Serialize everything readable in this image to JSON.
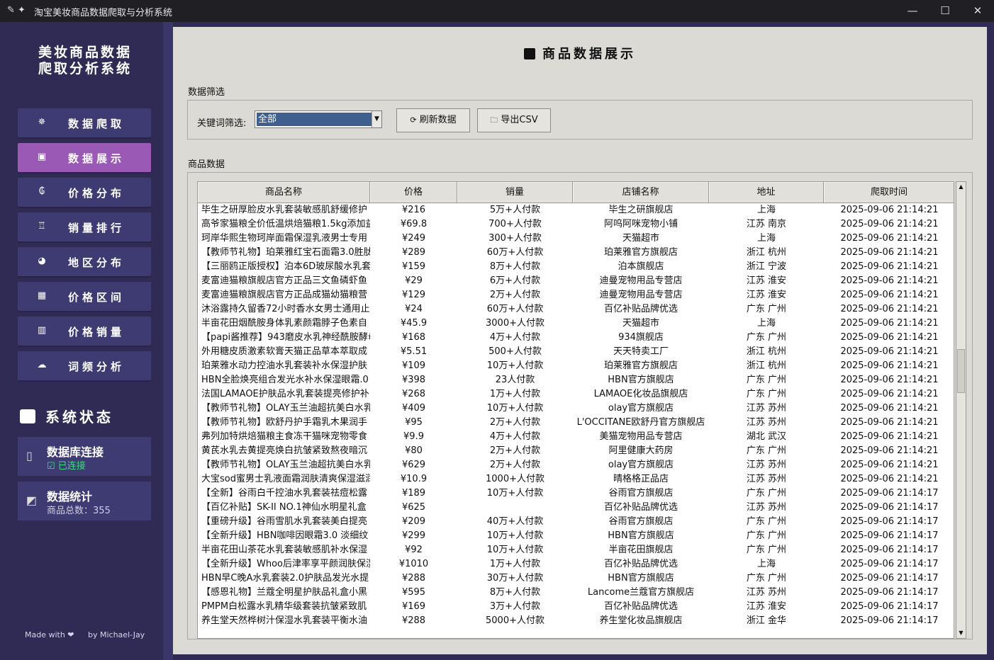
{
  "window": {
    "title": "淘宝美妆商品数据爬取与分析系统",
    "icons": "✎ ✦"
  },
  "sidebar": {
    "logo_line1": "美妆商品数据",
    "logo_line2": "爬取分析系统",
    "items": [
      {
        "label": "数据爬取",
        "icon": "✵",
        "icon_name": "spider-icon",
        "active": false
      },
      {
        "label": "数据展示",
        "icon": "▣",
        "icon_name": "box-icon",
        "active": true
      },
      {
        "label": "价格分布",
        "icon": "₲",
        "icon_name": "money-bag-icon",
        "active": false
      },
      {
        "label": "销量排行",
        "icon": "♖",
        "icon_name": "trophy-icon",
        "active": false
      },
      {
        "label": "地区分布",
        "icon": "◕",
        "icon_name": "globe-icon",
        "active": false
      },
      {
        "label": "价格区间",
        "icon": "▦",
        "icon_name": "chart-icon",
        "active": false
      },
      {
        "label": "价格销量",
        "icon": "▥",
        "icon_name": "bar-chart-icon",
        "active": false
      },
      {
        "label": "词频分析",
        "icon": "☁",
        "icon_name": "cloud-icon",
        "active": false
      }
    ],
    "system_status_title": "系统状态",
    "db_card": {
      "title": "数据库连接",
      "status": "☑ 已连接",
      "icon": "▯"
    },
    "stats_card": {
      "title": "数据统计",
      "subtitle": "商品总数：355",
      "icon": "◩"
    },
    "footer_left": "Made with ❤",
    "footer_right": "by Michael-Jay"
  },
  "main": {
    "page_title": "商品数据展示",
    "filter_section_label": "数据筛选",
    "keyword_label": "关键词筛选:",
    "keyword_value": "全部",
    "refresh_button": "刷新数据",
    "export_button": "导出CSV",
    "table_section_label": "商品数据",
    "columns": [
      "商品名称",
      "价格",
      "销量",
      "店铺名称",
      "地址",
      "爬取时间"
    ],
    "rows": [
      [
        "毕生之研厚脸皮水乳套装敏感肌舒缓修护",
        "¥216",
        "5万+人付款",
        "毕生之研旗舰店",
        "上海",
        "2025-09-06 21:14:21"
      ],
      [
        "高爷家猫粮全价低温烘焙猫粮1.5kg添加益",
        "¥69.8",
        "700+人付款",
        "阿呜阿咪宠物小铺",
        "江苏 南京",
        "2025-09-06 21:14:21"
      ],
      [
        "珂岸华熙生物珂岸面霜保湿乳液男士专用",
        "¥249",
        "300+人付款",
        "天猫超市",
        "上海",
        "2025-09-06 21:14:21"
      ],
      [
        "【教师节礼物】珀莱雅红宝石面霜3.0胜肽",
        "¥289",
        "60万+人付款",
        "珀莱雅官方旗舰店",
        "浙江 杭州",
        "2025-09-06 21:14:21"
      ],
      [
        "【三丽鸥正版授权】泊本6D玻尿酸水乳套",
        "¥159",
        "8万+人付款",
        "泊本旗舰店",
        "浙江 宁波",
        "2025-09-06 21:14:21"
      ],
      [
        "麦富迪猫粮旗舰店官方正品三文鱼磷虾鱼",
        "¥29",
        "6万+人付款",
        "迪曼宠物用品专营店",
        "江苏 淮安",
        "2025-09-06 21:14:21"
      ],
      [
        "麦富迪猫粮旗舰店官方正品成猫幼猫粮营",
        "¥129",
        "2万+人付款",
        "迪曼宠物用品专营店",
        "江苏 淮安",
        "2025-09-06 21:14:21"
      ],
      [
        "沐浴露持久留香72小时香水女男士通用止",
        "¥24",
        "60万+人付款",
        "百亿补贴品牌优选",
        "广东 广州",
        "2025-09-06 21:14:21"
      ],
      [
        "半亩花田烟酰胺身体乳素颜霜脖子色素自",
        "¥45.9",
        "3000+人付款",
        "天猫超市",
        "上海",
        "2025-09-06 21:14:21"
      ],
      [
        "【papi酱推荐】943磨皮水乳神经酰胺酵母",
        "¥168",
        "4万+人付款",
        "934旗舰店",
        "广东 广州",
        "2025-09-06 21:14:21"
      ],
      [
        "外用糖皮质激素软膏天猫正品草本萃取成",
        "¥5.51",
        "500+人付款",
        "天天特卖工厂",
        "浙江 杭州",
        "2025-09-06 21:14:21"
      ],
      [
        "珀莱雅水动力控油水乳套装补水保湿护肤",
        "¥109",
        "10万+人付款",
        "珀莱雅官方旗舰店",
        "浙江 杭州",
        "2025-09-06 21:14:21"
      ],
      [
        "HBN全脸焕亮组合发光水补水保湿眼霜.0",
        "¥398",
        "23人付款",
        "HBN官方旗舰店",
        "广东 广州",
        "2025-09-06 21:14:21"
      ],
      [
        "法国LAMAOE护肤品水乳套装提亮修护补",
        "¥268",
        "1万+人付款",
        "LAMAOE化妆品旗舰店",
        "广东 广州",
        "2025-09-06 21:14:21"
      ],
      [
        "【教师节礼物】OLAY玉兰油超抗美白水乳",
        "¥409",
        "10万+人付款",
        "olay官方旗舰店",
        "江苏 苏州",
        "2025-09-06 21:14:21"
      ],
      [
        "【教师节礼物】欧舒丹护手霜乳木果润手",
        "¥95",
        "2万+人付款",
        "L'OCCITANE欧舒丹官方旗舰店",
        "江苏 苏州",
        "2025-09-06 21:14:21"
      ],
      [
        "弗列加特烘焙猫粮主食冻干猫咪宠物零食",
        "¥9.9",
        "4万+人付款",
        "美猫宠物用品专营店",
        "湖北 武汉",
        "2025-09-06 21:14:21"
      ],
      [
        "黄芪水乳去黄提亮焕白抗皱紧致熬夜暗沉",
        "¥80",
        "2万+人付款",
        "阿里健康大药房",
        "广东 广州",
        "2025-09-06 21:14:21"
      ],
      [
        "【教师节礼物】OLAY玉兰油超抗美白水乳",
        "¥629",
        "2万+人付款",
        "olay官方旗舰店",
        "江苏 苏州",
        "2025-09-06 21:14:21"
      ],
      [
        "大宝sod蜜男士乳液面霜润肤清爽保湿滋润",
        "¥10.9",
        "1000+人付款",
        "晴格格正品店",
        "江苏 苏州",
        "2025-09-06 21:14:21"
      ],
      [
        "【全新】谷雨白千控油水乳套装祛痘松露",
        "¥189",
        "10万+人付款",
        "谷雨官方旗舰店",
        "广东 广州",
        "2025-09-06 21:14:17"
      ],
      [
        "【百亿补贴】SK-II NO.1神仙水明星礼盒",
        "¥625",
        "",
        "百亿补贴品牌优选",
        "江苏 苏州",
        "2025-09-06 21:14:17"
      ],
      [
        "【重磅升级】谷雨雪肌水乳套装美白提亮",
        "¥209",
        "40万+人付款",
        "谷雨官方旗舰店",
        "广东 广州",
        "2025-09-06 21:14:17"
      ],
      [
        "【全新升级】HBN咖啡因眼霜3.0 淡细纹",
        "¥299",
        "10万+人付款",
        "HBN官方旗舰店",
        "广东 广州",
        "2025-09-06 21:14:17"
      ],
      [
        "半亩花田山茶花水乳套装敏感肌补水保湿",
        "¥92",
        "10万+人付款",
        "半亩花田旗舰店",
        "广东 广州",
        "2025-09-06 21:14:17"
      ],
      [
        "【全新升级】Whoo后津率享平颜润肤保湿",
        "¥1010",
        "1万+人付款",
        "百亿补贴品牌优选",
        "上海",
        "2025-09-06 21:14:17"
      ],
      [
        "HBN早C晚A水乳套装2.0护肤品发光水提",
        "¥288",
        "30万+人付款",
        "HBN官方旗舰店",
        "广东 广州",
        "2025-09-06 21:14:17"
      ],
      [
        "【感恩礼物】兰蔻全明星护肤品礼盒小黑",
        "¥595",
        "8万+人付款",
        "Lancome兰蔻官方旗舰店",
        "江苏 苏州",
        "2025-09-06 21:14:17"
      ],
      [
        "PMPM白松露水乳精华级套装抗皱紧致肌",
        "¥169",
        "3万+人付款",
        "百亿补贴品牌优选",
        "江苏 淮安",
        "2025-09-06 21:14:17"
      ],
      [
        "养生堂天然桦树汁保湿水乳套装平衡水油",
        "¥288",
        "5000+人付款",
        "养生堂化妆品旗舰店",
        "浙江 金华",
        "2025-09-06 21:14:17"
      ]
    ]
  }
}
